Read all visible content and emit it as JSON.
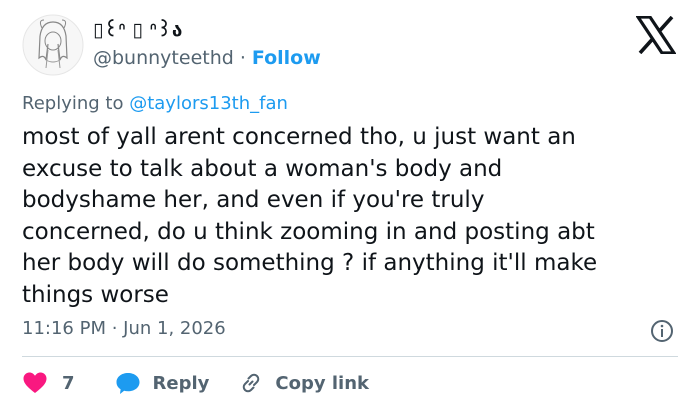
{
  "author": {
    "display_name": "▯꒰ᐢ ▯ ᐢ꒱ა",
    "handle": "@bunnyteethd",
    "separator": "·",
    "follow_label": "Follow",
    "avatar_icon": "anime-girl-sketch-avatar"
  },
  "reply_to": {
    "prefix": "Replying to ",
    "mention": "@taylors13th_fan"
  },
  "tweet": {
    "lines": [
      "most of yall arent concerned tho, u just want an",
      "excuse to talk about a woman's body and",
      "bodyshame her, and even if you're truly",
      "concerned, do u think zooming in and posting abt",
      "her body will do something ? if anything it'll make",
      "things worse"
    ],
    "timestamp": "11:16 PM · Jun 1, 2026"
  },
  "actions": {
    "like_count": "7",
    "reply_label": "Reply",
    "copy_link_label": "Copy link"
  },
  "colors": {
    "accent": "#1d9bf0",
    "like": "#f91880",
    "muted": "#536471",
    "text": "#0f1419"
  }
}
